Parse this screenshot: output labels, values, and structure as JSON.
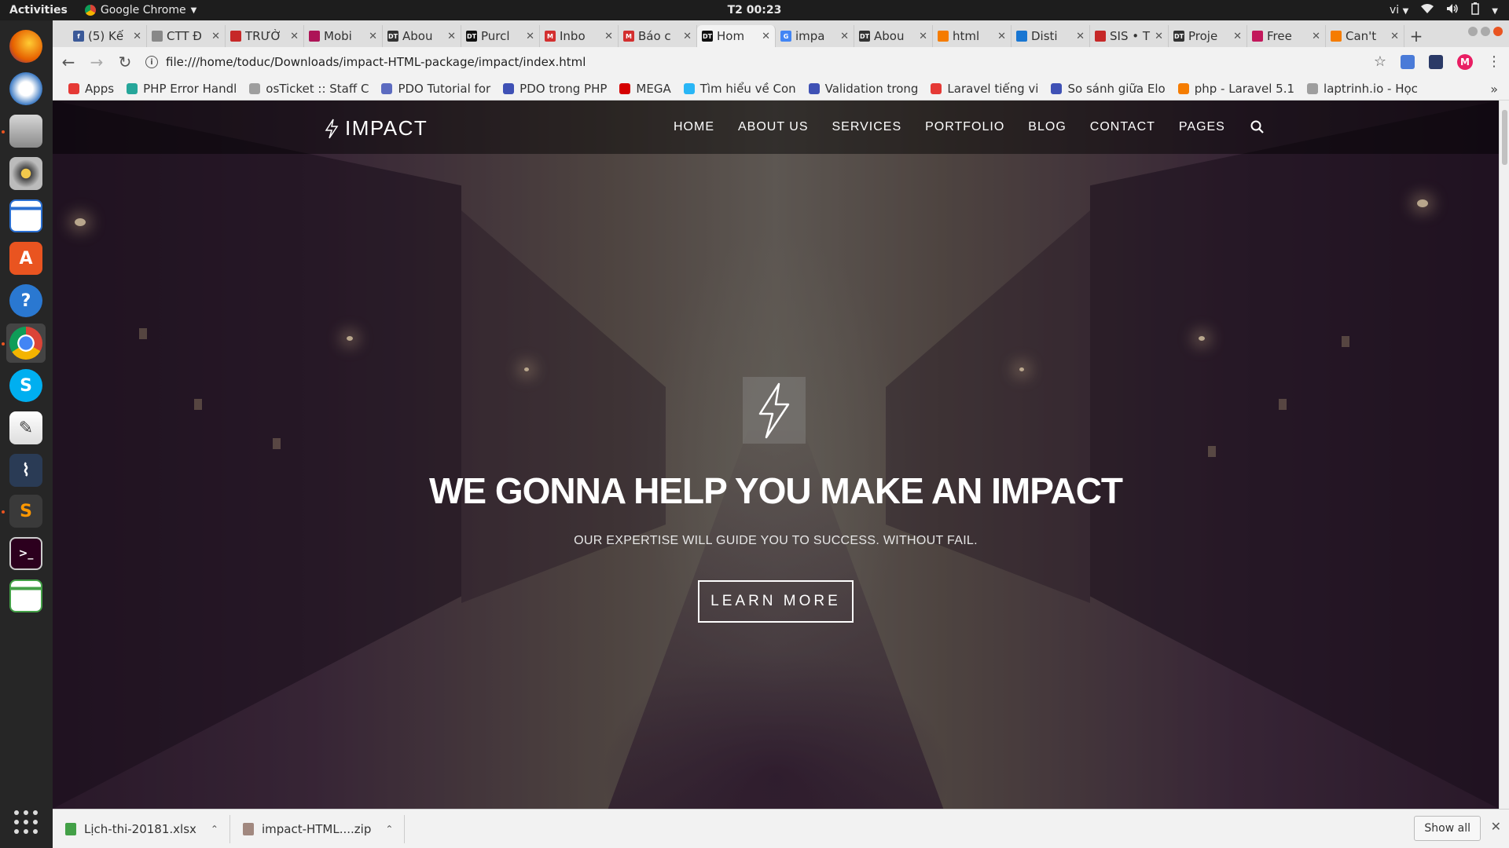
{
  "system": {
    "activities": "Activities",
    "app_name": "Google Chrome",
    "clock": "T2 00:23",
    "lang": "vi"
  },
  "tabs": [
    {
      "label": "(5) Kế",
      "fav_color": "#3b5998",
      "fav_text": "f"
    },
    {
      "label": "CTT Đ",
      "fav_color": "#888888",
      "fav_text": ""
    },
    {
      "label": "TRƯỜ",
      "fav_color": "#c62828",
      "fav_text": ""
    },
    {
      "label": "Mobi",
      "fav_color": "#ad1457",
      "fav_text": ""
    },
    {
      "label": "Abou",
      "fav_color": "#333333",
      "fav_text": "DT"
    },
    {
      "label": "Purcl",
      "fav_color": "#111111",
      "fav_text": "DT"
    },
    {
      "label": "Inbo",
      "fav_color": "#d32f2f",
      "fav_text": "M"
    },
    {
      "label": "Báo c",
      "fav_color": "#d32f2f",
      "fav_text": "M"
    },
    {
      "label": "Hom",
      "fav_color": "#111111",
      "fav_text": "DT"
    },
    {
      "label": "impa",
      "fav_color": "#4285f4",
      "fav_text": "G"
    },
    {
      "label": "Abou",
      "fav_color": "#333333",
      "fav_text": "DT"
    },
    {
      "label": "html",
      "fav_color": "#f57c00",
      "fav_text": ""
    },
    {
      "label": "Disti",
      "fav_color": "#1976d2",
      "fav_text": ""
    },
    {
      "label": "SIS • T",
      "fav_color": "#c62828",
      "fav_text": ""
    },
    {
      "label": "Proje",
      "fav_color": "#333333",
      "fav_text": "DT"
    },
    {
      "label": "Free",
      "fav_color": "#c2185b",
      "fav_text": ""
    },
    {
      "label": "Can't",
      "fav_color": "#f57c00",
      "fav_text": ""
    }
  ],
  "active_tab_index": 8,
  "address_bar": {
    "url": "file:///home/toduc/Downloads/impact-HTML-package/impact/index.html"
  },
  "bookmarks": [
    {
      "label": "Apps",
      "color": "#e53935"
    },
    {
      "label": "PHP Error Handl",
      "color": "#26a69a"
    },
    {
      "label": "osTicket :: Staff C",
      "color": "#9e9e9e"
    },
    {
      "label": "PDO Tutorial for",
      "color": "#5c6bc0"
    },
    {
      "label": "PDO trong PHP",
      "color": "#3f51b5"
    },
    {
      "label": "MEGA",
      "color": "#d50000"
    },
    {
      "label": "Tìm hiểu về Con",
      "color": "#29b6f6"
    },
    {
      "label": "Validation trong",
      "color": "#3f51b5"
    },
    {
      "label": "Laravel tiếng vi",
      "color": "#e53935"
    },
    {
      "label": "So sánh giữa Elo",
      "color": "#3f51b5"
    },
    {
      "label": "php - Laravel 5.1",
      "color": "#f57c00"
    },
    {
      "label": "laptrinh.io - Học",
      "color": "#9e9e9e"
    }
  ],
  "site": {
    "logo_text": "IMPACT",
    "nav": [
      "HOME",
      "ABOUT US",
      "SERVICES",
      "PORTFOLIO",
      "BLOG",
      "CONTACT",
      "PAGES"
    ],
    "hero_title": "WE GONNA HELP YOU MAKE AN IMPACT",
    "hero_subtitle": "OUR EXPERTISE WILL GUIDE YOU TO SUCCESS. WITHOUT FAIL.",
    "hero_button": "LEARN MORE"
  },
  "downloads": {
    "items": [
      {
        "name": "Lịch-thi-20181.xlsx",
        "color": "#43a047"
      },
      {
        "name": "impact-HTML....zip",
        "color": "#a1887f"
      }
    ],
    "show_all": "Show all"
  },
  "profile_initial": "M",
  "colors": {
    "ubuntu_orange": "#e95420",
    "chrome_chrome": "#f2f2f2"
  }
}
